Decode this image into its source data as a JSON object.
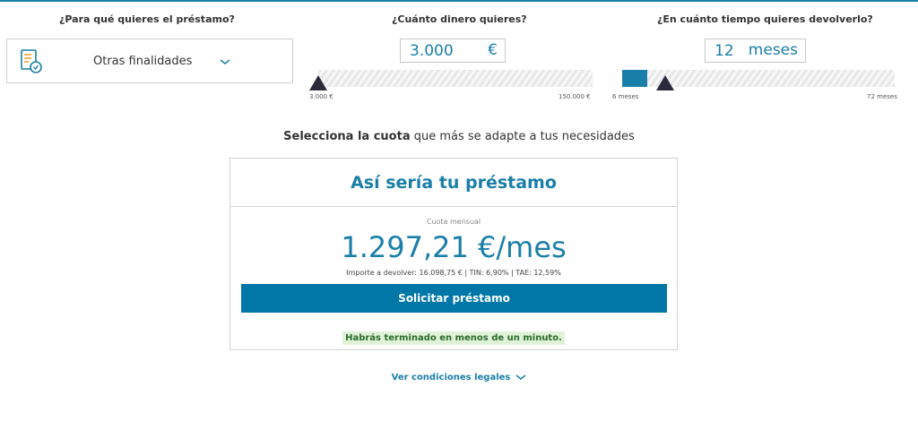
{
  "questions": {
    "purpose": "¿Para qué quieres el préstamo?",
    "amount": "¿Cuánto dinero quieres?",
    "term": "¿En cuánto tiempo quieres devolverlo?"
  },
  "purpose_select": {
    "selected": "Otras finalidades",
    "icon": "document-check-icon",
    "chevron": "chevron-down-icon"
  },
  "amount": {
    "value": "3.000",
    "unit": "€",
    "min_label": "3.000 €",
    "max_label": "150.000 €",
    "min": 3000,
    "max": 150000,
    "current": 3000
  },
  "term": {
    "value": "12",
    "unit": "meses",
    "min_label": "6 meses",
    "max_label": "72 meses",
    "min": 6,
    "max": 72,
    "current": 12
  },
  "instruction": {
    "bold": "Selecciona la cuota",
    "rest": " que más se adapte a tus necesidades"
  },
  "card": {
    "title": "Así sería tu préstamo",
    "cuota_label": "Cuota mensual",
    "amount": "1.297,21 €/mes",
    "details": "Importe a devolver: 16.098,75 € | TIN: 6,90% | TAE: 12,59%",
    "button": "Solicitar préstamo",
    "hint": "Habrás terminado en menos de un minuto."
  },
  "legal": {
    "link": "Ver condiciones legales"
  },
  "colors": {
    "brand": "#1a7fa8",
    "button": "#0077a6",
    "hint_bg": "#dff2d8",
    "hint_text": "#2b6a2b"
  }
}
